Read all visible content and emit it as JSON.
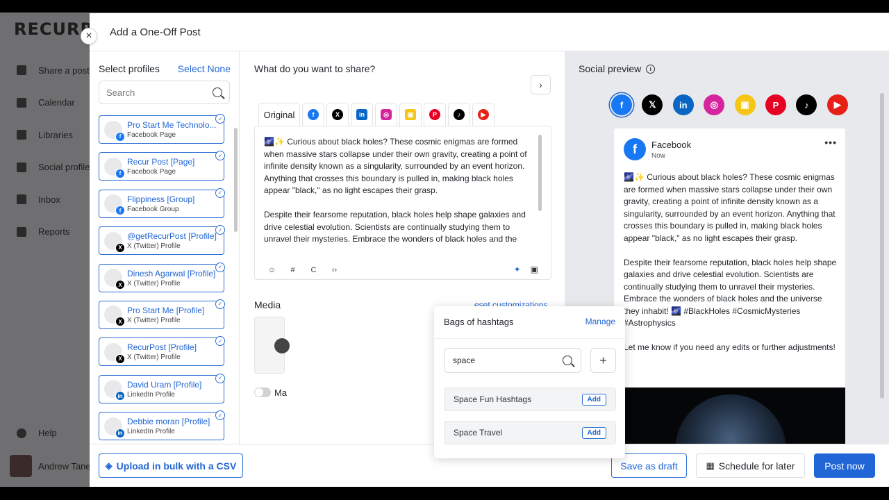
{
  "background_app": {
    "logo": "RECURR",
    "nav": [
      "Share a post",
      "Calendar",
      "Libraries",
      "Social profile",
      "Inbox",
      "Reports"
    ],
    "help": "Help",
    "user": "Andrew Tane"
  },
  "modal": {
    "title": "Add a One-Off Post",
    "close_icon": "×"
  },
  "profiles": {
    "heading": "Select profiles",
    "select_none": "Select None",
    "search_placeholder": "Search",
    "items": [
      {
        "name": "Pro Start Me Technolo...",
        "type": "Facebook Page",
        "network": "facebook"
      },
      {
        "name": "Recur Post [Page]",
        "type": "Facebook Page",
        "network": "facebook"
      },
      {
        "name": "Flippiness [Group]",
        "type": "Facebook Group",
        "network": "facebook"
      },
      {
        "name": "@getRecurPost [Profile]",
        "type": "X (Twitter) Profile",
        "network": "x"
      },
      {
        "name": "Dinesh Agarwal [Profile]",
        "type": "X (Twitter) Profile",
        "network": "x"
      },
      {
        "name": "Pro Start Me [Profile]",
        "type": "X (Twitter) Profile",
        "network": "x"
      },
      {
        "name": "RecurPost [Profile]",
        "type": "X (Twitter) Profile",
        "network": "x"
      },
      {
        "name": "David Uram [Profile]",
        "type": "LinkedIn Profile",
        "network": "linkedin"
      },
      {
        "name": "Debbie moran [Profile]",
        "type": "LinkedIn Profile",
        "network": "linkedin"
      }
    ]
  },
  "compose": {
    "title": "What do you want to share?",
    "next_icon": "›",
    "tabs": [
      "Original",
      "facebook",
      "x",
      "linkedin",
      "instagram",
      "google-business",
      "pinterest",
      "tiktok",
      "youtube"
    ],
    "tab_original_label": "Original",
    "text": "🌌✨ Curious about black holes? These cosmic enigmas are formed when massive stars collapse under their own gravity, creating a point of infinite density known as a singularity, surrounded by an event horizon. Anything that crosses this boundary is pulled in, making black holes appear \"black,\" as no light escapes their grasp.\n\nDespite their fearsome reputation, black holes help shape galaxies and drive celestial evolution. Scientists are continually studying them to unravel their mysteries. Embrace the wonders of black holes and the",
    "media_label": "Media",
    "reset_link": "eset customizations",
    "toggle_label": "Ma"
  },
  "hashtags_popover": {
    "title": "Bags of hashtags",
    "manage": "Manage",
    "search_value": "space",
    "plus": "+",
    "bags": [
      {
        "name": "Space Fun Hashtags",
        "add": "Add"
      },
      {
        "name": "Space Travel",
        "add": "Add"
      }
    ]
  },
  "preview": {
    "title": "Social preview",
    "info_icon": "i",
    "networks": [
      {
        "name": "facebook",
        "glyph": "f",
        "color": "#1877f2",
        "active": true
      },
      {
        "name": "x",
        "glyph": "𝕏",
        "color": "#000000"
      },
      {
        "name": "linkedin",
        "glyph": "in",
        "color": "#0a66c2"
      },
      {
        "name": "instagram",
        "glyph": "◎",
        "color": "#d6249f"
      },
      {
        "name": "google-business",
        "glyph": "▣",
        "color": "#f5c518"
      },
      {
        "name": "pinterest",
        "glyph": "P",
        "color": "#e60023"
      },
      {
        "name": "tiktok",
        "glyph": "♪",
        "color": "#000000"
      },
      {
        "name": "youtube",
        "glyph": "▶",
        "color": "#e62117"
      }
    ],
    "card": {
      "page_name": "Facebook",
      "time": "Now",
      "menu": "•••",
      "text": "🌌✨ Curious about black holes? These cosmic enigmas are formed when massive stars collapse under their own gravity, creating a point of infinite density known as a singularity, surrounded by an event horizon. Anything that crosses this boundary is pulled in, making black holes appear \"black,\" as no light escapes their grasp.\n\nDespite their fearsome reputation, black holes help shape galaxies and drive celestial evolution. Scientists are continually studying them to unravel their mysteries. Embrace the wonders of black holes and the universe they inhabit! 🌌 #BlackHoles #CosmicMysteries #Astrophysics\n\nLet me know if you need any edits or further adjustments!"
    }
  },
  "footer": {
    "upload_csv": "Upload in bulk with a CSV",
    "save_draft": "Save as draft",
    "schedule": "Schedule for later",
    "post_now": "Post now"
  },
  "colors": {
    "accent": "#2166d6",
    "facebook": "#1877f2"
  }
}
